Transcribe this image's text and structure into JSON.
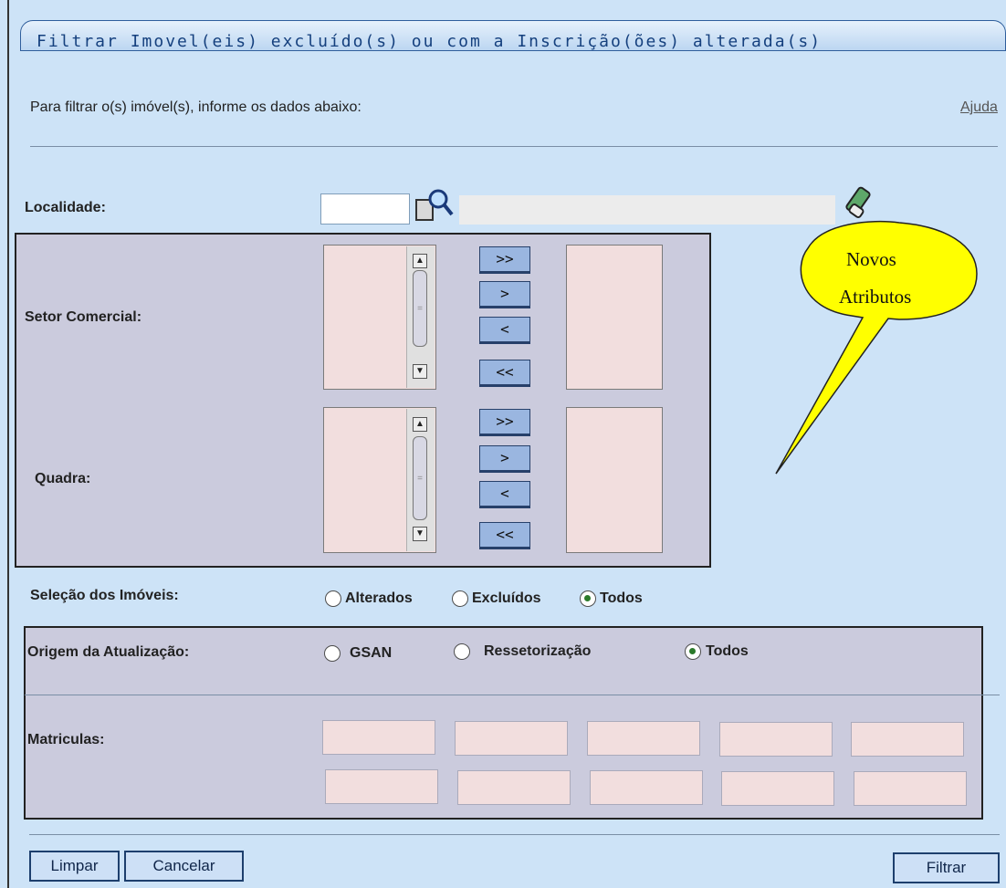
{
  "page": {
    "title": "Filtrar Imovel(eis) excluído(s) ou com a Inscrição(ões) alterada(s)",
    "instructions": "Para filtrar o(s) imóvel(s), informe os dados abaixo:",
    "help_link": "Ajuda"
  },
  "localidade": {
    "label": "Localidade:",
    "code_value": "",
    "name_value": ""
  },
  "setor_comercial": {
    "label": "Setor Comercial:"
  },
  "quadra": {
    "label": "Quadra:"
  },
  "move_buttons": {
    "add_all": ">>",
    "add_one": ">",
    "remove_one": "<",
    "remove_all": "<<"
  },
  "selecao": {
    "label": "Seleção dos Imóveis:",
    "options": [
      "Alterados",
      "Excluídos",
      "Todos"
    ],
    "selected": "Todos"
  },
  "origem": {
    "label": "Origem da Atualização:",
    "options": [
      "GSAN",
      "Ressetorização",
      "Todos"
    ],
    "selected": "Todos"
  },
  "matriculas": {
    "label": "Matriculas:",
    "values": [
      "",
      "",
      "",
      "",
      "",
      "",
      "",
      "",
      "",
      ""
    ]
  },
  "callout": {
    "line1": "Novos",
    "line2": "Atributos"
  },
  "footer": {
    "clear": "Limpar",
    "cancel": "Cancelar",
    "filter": "Filtrar"
  },
  "icons": [
    "search-icon",
    "eraser-icon",
    "scroll-up-icon",
    "scroll-down-icon",
    "radio-icon"
  ],
  "colors": {
    "background": "#cde3f7",
    "panel": "#cbcbdd",
    "listbox": "#f2dede",
    "button": "#9ab6e0",
    "callout": "#ffff00",
    "title": "#15407e"
  }
}
